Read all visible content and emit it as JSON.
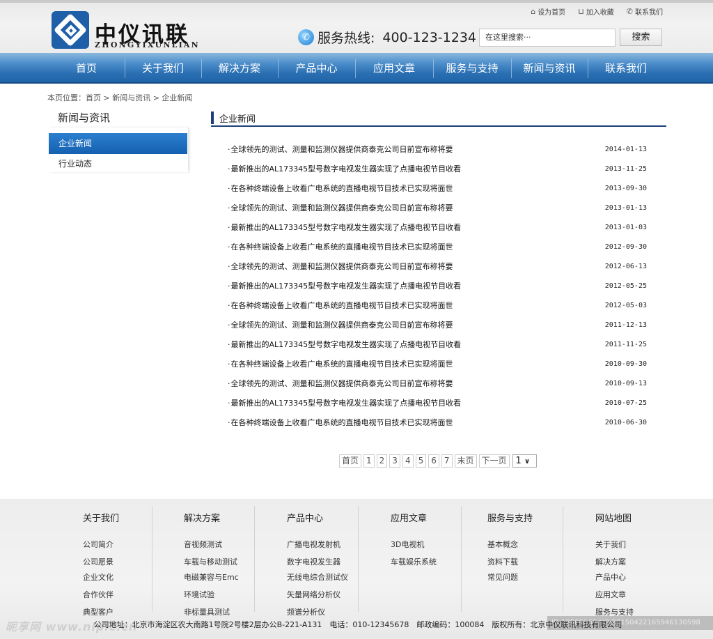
{
  "header": {
    "brand_cn": "中仪讯联",
    "brand_en": "ZHONGYIXUNLIAN",
    "top_links": [
      {
        "icon": "home-icon",
        "glyph": "⌂",
        "label": "设为首页"
      },
      {
        "icon": "cart-icon",
        "glyph": "🛒",
        "label": "加入收藏"
      },
      {
        "icon": "phone-icon",
        "glyph": "✆",
        "label": "联系我们"
      }
    ],
    "hotline_label": "服务热线:",
    "hotline_number": "400-123-1234",
    "search_placeholder": "在这里搜索···",
    "search_button": "搜索"
  },
  "nav": {
    "items": [
      "首页",
      "关于我们",
      "解决方案",
      "产品中心",
      "应用文章",
      "服务与支持",
      "新闻与资讯",
      "联系我们"
    ]
  },
  "breadcrumb": "本页位置：首页 > 新闻与资讯 > 企业新闻",
  "sidebar": {
    "title": "新闻与资讯",
    "items": [
      {
        "label": "企业新闻",
        "active": true
      },
      {
        "label": "行业动态",
        "active": false
      }
    ]
  },
  "main": {
    "section_title": "企业新闻",
    "news": [
      {
        "title": "全球领先的测试、测量和监测仪器提供商泰克公司日前宣布称将要",
        "date": "2014-01-13"
      },
      {
        "title": "最新推出的AL173345型号数字电视发生器实现了点播电视节目收看",
        "date": "2013-11-25"
      },
      {
        "title": "在各种终端设备上收看广电系统的直播电视节目技术已实现将面世",
        "date": "2013-09-30"
      },
      {
        "title": "全球领先的测试、测量和监测仪器提供商泰克公司日前宣布称将要",
        "date": "2013-01-13"
      },
      {
        "title": "最新推出的AL173345型号数字电视发生器实现了点播电视节目收看",
        "date": "2013-01-03"
      },
      {
        "title": "在各种终端设备上收看广电系统的直播电视节目技术已实现将面世",
        "date": "2012-09-30"
      },
      {
        "title": "全球领先的测试、测量和监测仪器提供商泰克公司日前宣布称将要",
        "date": "2012-06-13"
      },
      {
        "title": "最新推出的AL173345型号数字电视发生器实现了点播电视节目收看",
        "date": "2012-05-25"
      },
      {
        "title": "在各种终端设备上收看广电系统的直播电视节目技术已实现将面世",
        "date": "2012-05-03"
      },
      {
        "title": "全球领先的测试、测量和监测仪器提供商泰克公司日前宣布称将要",
        "date": "2011-12-13"
      },
      {
        "title": "最新推出的AL173345型号数字电视发生器实现了点播电视节目收看",
        "date": "2011-11-25"
      },
      {
        "title": "在各种终端设备上收看广电系统的直播电视节目技术已实现将面世",
        "date": "2010-09-30"
      },
      {
        "title": "全球领先的测试、测量和监测仪器提供商泰克公司日前宣布称将要",
        "date": "2010-09-13"
      },
      {
        "title": "最新推出的AL173345型号数字电视发生器实现了点播电视节目收看",
        "date": "2010-07-25"
      },
      {
        "title": "在各种终端设备上收看广电系统的直播电视节目技术已实现将面世",
        "date": "2010-06-30"
      }
    ],
    "pagination": {
      "first": "首页",
      "pages": [
        "1",
        "2",
        "3",
        "4",
        "5",
        "6",
        "7"
      ],
      "last": "末页",
      "next": "下一页",
      "selected_page": "1"
    }
  },
  "footer": {
    "columns": [
      {
        "title": "关于我们",
        "items": [
          "公司简介",
          "公司愿景",
          "企业文化",
          "合作伙伴",
          "典型客户"
        ]
      },
      {
        "title": "解决方案",
        "items": [
          "音视频测试",
          "车载与移动测试",
          "电磁兼容与Emc",
          "环境试验",
          "非标量具测试"
        ]
      },
      {
        "title": "产品中心",
        "items": [
          "广播电视发射机",
          "数字电视发生器",
          "无线电综合测试仪",
          "矢量网络分析仪",
          "频谱分析仪"
        ]
      },
      {
        "title": "应用文章",
        "items": [
          "3D电视机",
          "车载娱乐系统"
        ]
      },
      {
        "title": "服务与支持",
        "items": [
          "基本概念",
          "资料下载",
          "常见问题"
        ]
      },
      {
        "title": "网站地图",
        "items": [
          "关于我们",
          "解决方案",
          "产品中心",
          "应用文章",
          "服务与支持"
        ]
      }
    ],
    "address_line": "公司地址：北京市海淀区农大南路1号院2号楼2层办公B-221-A131　电话：010-12345678　邮政编码：100084　版权所有：北京中仪联讯科技有限公司",
    "watermark_left": "昵享网 www.nipic.cn",
    "watermark_right": "ID:18508166 NO:20150422165946130598"
  }
}
